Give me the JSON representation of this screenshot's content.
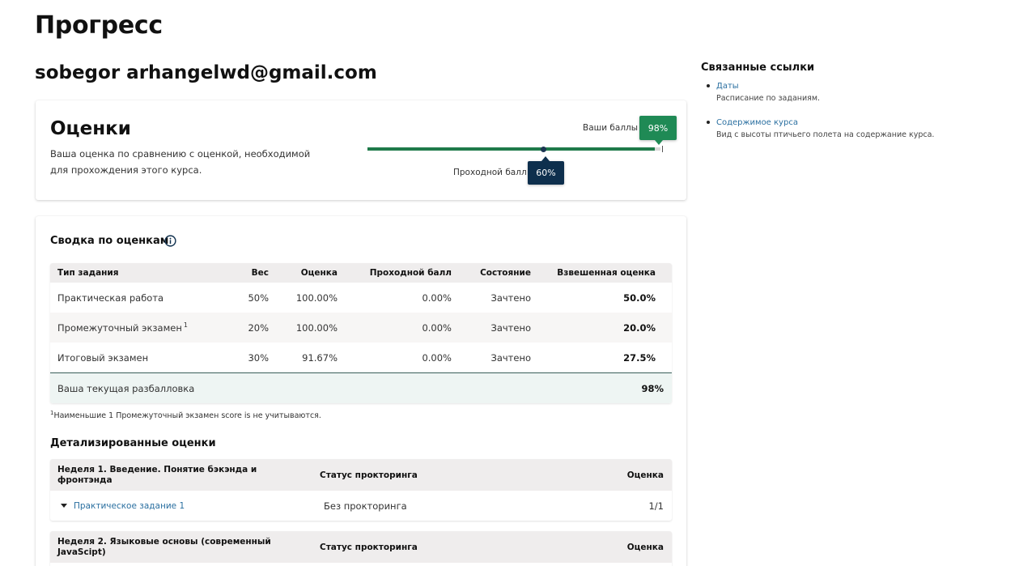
{
  "page": {
    "title": "Прогресс",
    "username": "sobegor arhangelwd@gmail.com"
  },
  "grades_card": {
    "title": "Оценки",
    "description": "Ваша оценка по сравнению с оценкой, необходимой для прохождения этого курса.",
    "user_label": "Ваши баллы",
    "user_score": "98%",
    "user_fraction": 0.98,
    "pass_label": "Проходной балл",
    "pass_score": "60%",
    "pass_fraction": 0.6,
    "colors": {
      "user": "#1f8a55",
      "pass": "#0e2f4d",
      "bar": "#1f7a4a"
    }
  },
  "summary": {
    "title": "Сводка по оценкам",
    "info_icon": "info-icon",
    "headers": [
      "Тип задания",
      "Вес",
      "Оценка",
      "Проходной балл",
      "Состояние",
      "Взвешенная оценка"
    ],
    "rows": [
      {
        "type": "Практическая работа",
        "sup": "",
        "weight": "50%",
        "grade": "100.00%",
        "pass": "0.00%",
        "status": "Зачтено",
        "weighted": "50.0%"
      },
      {
        "type": "Промежуточный экзамен",
        "sup": "1",
        "weight": "20%",
        "grade": "100.00%",
        "pass": "0.00%",
        "status": "Зачтено",
        "weighted": "20.0%"
      },
      {
        "type": "Итоговый экзамен",
        "sup": "",
        "weight": "30%",
        "grade": "91.67%",
        "pass": "0.00%",
        "status": "Зачтено",
        "weighted": "27.5%"
      }
    ],
    "total_label": "Ваша текущая разбалловка",
    "total_value": "98%",
    "footnote_sup": "1",
    "footnote": "Наименьшие 1 Промежуточный экзамен score is не учитываются."
  },
  "detail": {
    "title": "Детализированные оценки",
    "weeks": [
      {
        "name": "Неделя 1. Введение. Понятие бэкэнда и фронтэнда",
        "proctoring_header": "Статус прокторинга",
        "grade_header": "Оценка",
        "items": [
          {
            "name": "Практическое задание 1",
            "proctoring": "Без прокторинга",
            "grade": "1/1"
          }
        ]
      },
      {
        "name": "Неделя 2. Языковые основы (современный JavaScipt)",
        "proctoring_header": "Статус прокторинга",
        "grade_header": "Оценка"
      }
    ]
  },
  "related": {
    "title": "Связанные ссылки",
    "links": [
      {
        "label": "Даты",
        "desc": "Расписание по заданиям."
      },
      {
        "label": "Содержимое курса",
        "desc": "Вид с высоты птичьего полета на содержание курса."
      }
    ]
  }
}
